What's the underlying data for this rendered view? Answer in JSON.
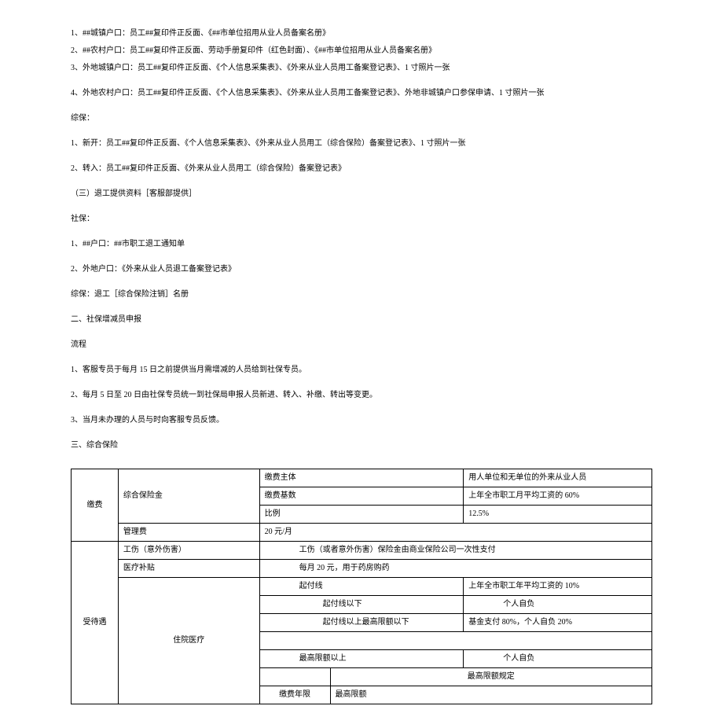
{
  "lines": {
    "l1": "1、##城镇户口：员工##复印件正反面、《##市单位招用从业人员备案名册》",
    "l2": "2、##农村户口：员工##复印件正反面、劳动手册复印件（红色封面）、《##市单位招用从业人员备案名册》",
    "l3": "3、外地城镇户口：员工##复印件正反面、《个人信息采集表》、《外来从业人员用工备案登记表》、1 寸照片一张",
    "l4": "4、外地农村户口：员工##复印件正反面、《个人信息采集表》、《外来从业人员用工备案登记表》、外地非城镇户口参保申请、1 寸照片一张",
    "zb": "综保：",
    "l5": "1、新开：员工##复印件正反面、《个人信息采集表》、《外来从业人员用工（综合保险）备案登记表》、1 寸照片一张",
    "l6": "2、转入：员工##复印件正反面、《外来从业人员用工（综合保险）备案登记表》",
    "l7": "（三）退工提供资料［客服部提供］",
    "sb": "社保：",
    "l8": "1、##户口：##市职工退工通知单",
    "l9": "2、外地户口：《外来从业人员退工备案登记表》",
    "l10": "综保：退工［综合保险注销］名册",
    "h2": "二、社保增减员申报",
    "lc": "流程",
    "p1": "1、客服专员于每月 15 日之前提供当月需增减的人员给到社保专员。",
    "p2": "2、每月 5 日至 20 日由社保专员统一到社保局申报人员新进、转入、补缴、转出等变更。",
    "p3": "3、当月未办理的人员与时向客服专员反馈。",
    "h3": "三、综合保险"
  },
  "table": {
    "r1c1": "缴费",
    "r1c2": "综合保险金",
    "r1c3": "缴费主体",
    "r1c4": "用人单位和无单位的外来从业人员",
    "r2c3": "缴费基数",
    "r2c4": "上年全市职工月平均工资的 60%",
    "r3c3": "比例",
    "r3c4": "12.5%",
    "r4c2": "管理费",
    "r4c3": "20 元/月",
    "r5c1": "受待遇",
    "r5c2": "工伤（意外伤害）",
    "r5c3": "工伤（或者意外伤害）保险金由商业保险公司一次性支付",
    "r6c2": "医疗补贴",
    "r6c3": "每月 20 元，用于药房购药",
    "r7c2": "住院医疗",
    "r7c3": "起付线",
    "r7c4": "上年全市职工年平均工资的 10%",
    "r8c3": "起付线以下",
    "r8c4": "个人自负",
    "r9c3": "起付线以上最高限额以下",
    "r9c4": "基金支付 80%，个人自负 20%",
    "r10c3": "最高限额以上",
    "r10c4": "个人自负",
    "r11c3": "",
    "r11c4": "最高限额规定",
    "r12c3": "缴费年限",
    "r12c4": "最高限额"
  }
}
